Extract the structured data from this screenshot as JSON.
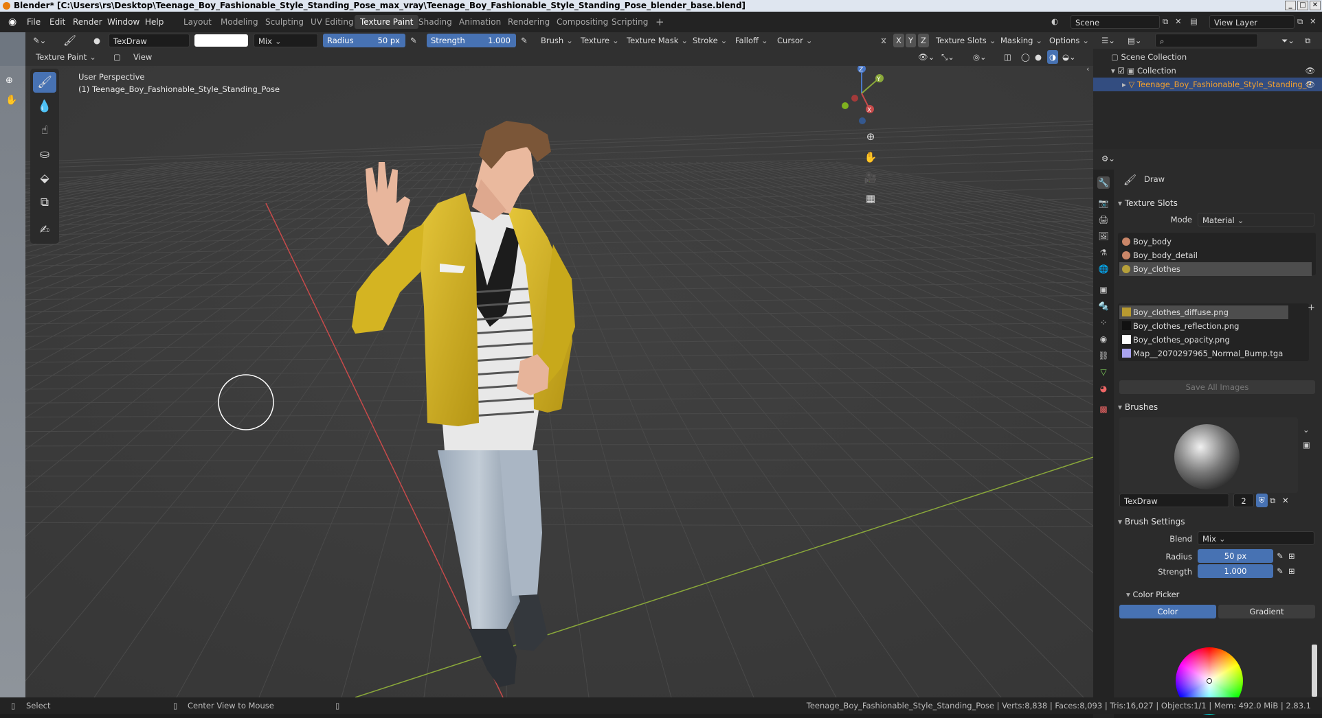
{
  "window": {
    "title": "Blender* [C:\\Users\\rs\\Desktop\\Teenage_Boy_Fashionable_Style_Standing_Pose_max_vray\\Teenage_Boy_Fashionable_Style_Standing_Pose_blender_base.blend]"
  },
  "menu": [
    "File",
    "Edit",
    "Render",
    "Window",
    "Help"
  ],
  "workspaces": [
    "Layout",
    "Modeling",
    "Sculpting",
    "UV Editing",
    "Texture Paint",
    "Shading",
    "Animation",
    "Rendering",
    "Compositing",
    "Scripting"
  ],
  "active_workspace": "Texture Paint",
  "scene": {
    "name": "Scene",
    "view_layer": "View Layer"
  },
  "tool_header": {
    "brush_name": "TexDraw",
    "blend": "Mix",
    "radius_label": "Radius",
    "radius_value": "50 px",
    "strength_label": "Strength",
    "strength_value": "1.000",
    "menus": [
      "Brush",
      "Texture",
      "Texture Mask",
      "Stroke",
      "Falloff",
      "Cursor"
    ],
    "axes": [
      "X",
      "Y",
      "Z"
    ],
    "right_menus": [
      "Texture Slots",
      "Masking",
      "Options"
    ]
  },
  "view_header": {
    "mode": "Texture Paint",
    "view": "View"
  },
  "viewport": {
    "perspective": "User Perspective",
    "object": "(1) Teenage_Boy_Fashionable_Style_Standing_Pose",
    "gizmo": {
      "z": "Z",
      "y": "Y",
      "x": "X"
    }
  },
  "colors": {
    "accent": "#4772b3",
    "jacket": "#d8b81f",
    "x_axis": "#c74a4a",
    "y_axis": "#8aa83a",
    "background": "#3b3b3b"
  },
  "outliner": {
    "scene_collection": "Scene Collection",
    "collection": "Collection",
    "object": "Teenage_Boy_Fashionable_Style_Standing_P"
  },
  "properties": {
    "tool_name": "Draw",
    "texture_slots": {
      "title": "Texture Slots",
      "mode_label": "Mode",
      "mode_value": "Material",
      "materials": [
        "Boy_body",
        "Boy_body_detail",
        "Boy_clothes"
      ],
      "images": [
        "Boy_clothes_diffuse.png",
        "Boy_clothes_reflection.png",
        "Boy_clothes_opacity.png",
        "Map__2070297965_Normal_Bump.tga"
      ],
      "save_all": "Save All Images"
    },
    "brushes": {
      "title": "Brushes",
      "brush_name": "TexDraw",
      "users": "2"
    },
    "brush_settings": {
      "title": "Brush Settings",
      "blend_label": "Blend",
      "blend_value": "Mix",
      "radius_label": "Radius",
      "radius_value": "50 px",
      "strength_label": "Strength",
      "strength_value": "1.000"
    },
    "color_picker": {
      "title": "Color Picker",
      "tab_color": "Color",
      "tab_gradient": "Gradient"
    }
  },
  "status": {
    "select": "Select",
    "center_view": "Center View to Mouse",
    "stats": "Teenage_Boy_Fashionable_Style_Standing_Pose | Verts:8,838 | Faces:8,093 | Tris:16,027 | Objects:1/1 | Mem: 492.0 MiB | 2.83.1"
  }
}
